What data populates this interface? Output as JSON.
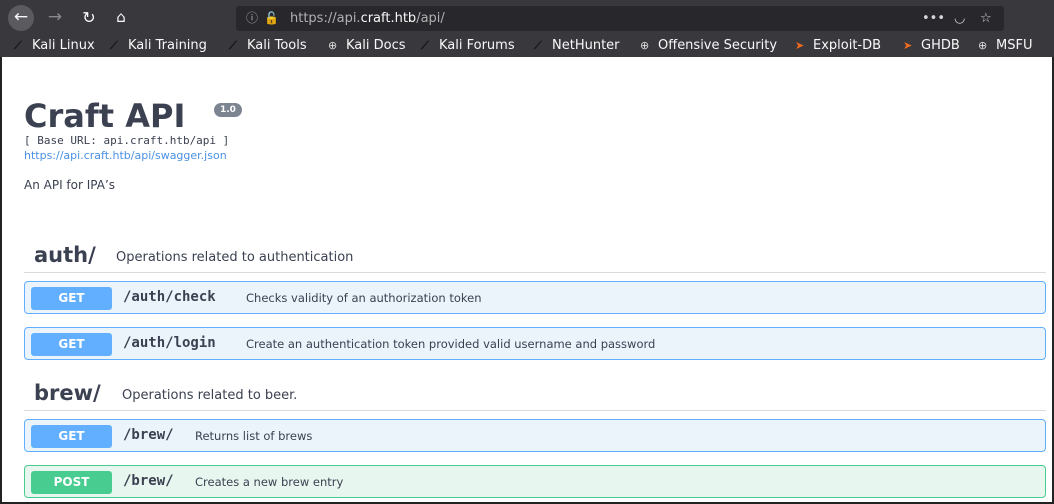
{
  "browser": {
    "url_prefix": "https://api.",
    "url_host": "craft.htb",
    "url_suffix": "/api/",
    "nav": {
      "back": "←",
      "forward": "→",
      "reload": "↻",
      "home": "⌂"
    },
    "page_actions": {
      "more": "•••",
      "pocket": "◡",
      "star": "☆"
    },
    "bookmarks": [
      {
        "label": "Kali Linux",
        "icon": "kali-dragon-icon"
      },
      {
        "label": "Kali Training",
        "icon": "kali-dragon-icon"
      },
      {
        "label": "Kali Tools",
        "icon": "kali-dragon-icon"
      },
      {
        "label": "Kali Docs",
        "icon": "globe-icon"
      },
      {
        "label": "Kali Forums",
        "icon": "kali-dragon-icon"
      },
      {
        "label": "NetHunter",
        "icon": "kali-dragon-icon"
      },
      {
        "label": "Offensive Security",
        "icon": "globe-icon"
      },
      {
        "label": "Exploit-DB",
        "icon": "exploitdb-icon"
      },
      {
        "label": "GHDB",
        "icon": "exploitdb-icon"
      },
      {
        "label": "MSFU",
        "icon": "globe-icon"
      }
    ]
  },
  "info": {
    "title": "Craft API",
    "version": "1.0",
    "base_url": "[ Base URL: api.craft.htb/api ]",
    "spec_link": "https://api.craft.htb/api/swagger.json",
    "description": "An API for IPA’s"
  },
  "tags": [
    {
      "name": "auth/",
      "description": "Operations related to authentication",
      "operations": [
        {
          "method": "GET",
          "path": "/auth/check",
          "summary": "Checks validity of an authorization token"
        },
        {
          "method": "GET",
          "path": "/auth/login",
          "summary": "Create an authentication token provided valid username and password"
        }
      ]
    },
    {
      "name": "brew/",
      "description": "Operations related to beer.",
      "operations": [
        {
          "method": "GET",
          "path": "/brew/",
          "summary": "Returns list of brews"
        },
        {
          "method": "POST",
          "path": "/brew/",
          "summary": "Creates a new brew entry"
        }
      ]
    }
  ],
  "colors": {
    "get": "#61affe",
    "post": "#49cc90",
    "text": "#3b4151",
    "link": "#4990e2"
  }
}
